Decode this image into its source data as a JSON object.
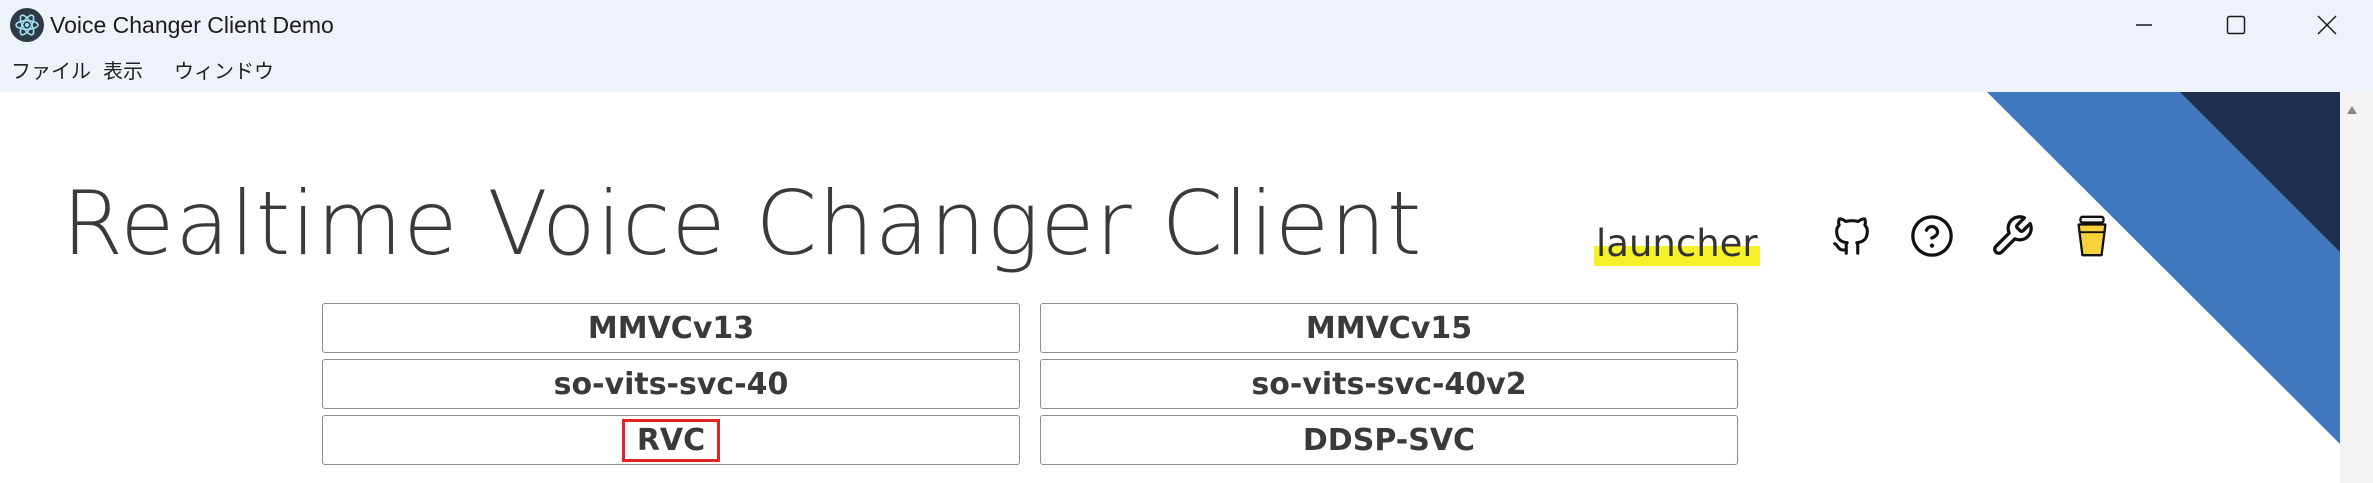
{
  "window": {
    "title": "Voice Changer Client Demo",
    "app_icon": "electron-atom-icon",
    "controls": [
      "minimize-icon",
      "maximize-icon",
      "close-icon"
    ]
  },
  "menubar": {
    "items": [
      {
        "label": "ファイル"
      },
      {
        "label": "表示"
      },
      {
        "label": "ウィンドウ"
      }
    ]
  },
  "header": {
    "title": "Realtime Voice Changer Client",
    "subtitle": "launcher",
    "subtitle_highlight_color": "#f5f22a",
    "icons": [
      "github-icon",
      "help-icon",
      "wrench-icon",
      "coffee-cup-icon"
    ]
  },
  "clients": [
    {
      "label": "MMVCv13",
      "highlighted": false
    },
    {
      "label": "MMVCv15",
      "highlighted": false
    },
    {
      "label": "so-vits-svc-40",
      "highlighted": false
    },
    {
      "label": "so-vits-svc-40v2",
      "highlighted": false
    },
    {
      "label": "RVC",
      "highlighted": true
    },
    {
      "label": "DDSP-SVC",
      "highlighted": false
    }
  ],
  "colors": {
    "titlebar_bg": "#eef2f9",
    "corner_blue": "#3f78bd",
    "corner_navy": "#1d2d4c",
    "highlight_box": "#e02424"
  }
}
